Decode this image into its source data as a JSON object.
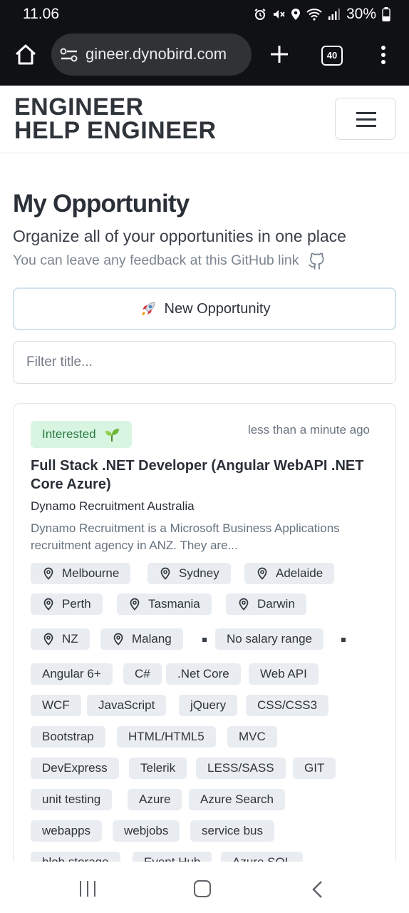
{
  "status_bar": {
    "time": "11.06",
    "battery": "30%"
  },
  "browser": {
    "url": "gineer.dynobird.com",
    "tab_count": "40"
  },
  "site": {
    "logo_line1": "ENGINEER",
    "logo_line2": "HELP ENGINEER"
  },
  "page": {
    "title": "My Opportunity",
    "subtitle": "Organize all of your opportunities in one place",
    "feedback": "You can leave any feedback at this GitHub link",
    "new_button": "New Opportunity",
    "filter_placeholder": "Filter title..."
  },
  "card": {
    "status": "Interested",
    "timestamp": "less than a minute ago",
    "title": "Full Stack .NET Developer (Angular WebAPI .NET Core Azure)",
    "company": "Dynamo Recruitment Australia",
    "description": "Dynamo Recruitment is a Microsoft Business Applications recruitment agency in ANZ. They are...",
    "locations": [
      "Melbourne",
      "Sydney",
      "Adelaide",
      "Perth",
      "Tasmania",
      "Darwin",
      "NZ",
      "Malang"
    ],
    "salary": "No salary range",
    "skills": [
      "Angular 6+",
      "C#",
      ".Net Core",
      "Web API",
      "WCF",
      "JavaScript",
      "jQuery",
      "CSS/CSS3",
      "Bootstrap",
      "HTML/HTML5",
      "MVC",
      "DevExpress",
      "Telerik",
      "LESS/SASS",
      "GIT",
      "unit testing",
      "Azure",
      "Azure Search",
      "webapps",
      "webjobs",
      "service bus",
      "blob storage",
      "Event Hub",
      "Azure SQL"
    ]
  },
  "colors": {
    "status_bg": "#d8f5e1",
    "status_text": "#2b7a45",
    "tag_bg": "#e9edf1",
    "browser_bg": "#101114"
  },
  "icons": {
    "home": "home-icon",
    "tune": "site-settings-icon",
    "plus": "plus-icon",
    "tabs": "tabs-icon",
    "menu": "more-vert-icon",
    "github": "github-icon",
    "rocket": "rocket-icon",
    "seedling": "seedling-icon",
    "pin": "map-pin-icon"
  }
}
